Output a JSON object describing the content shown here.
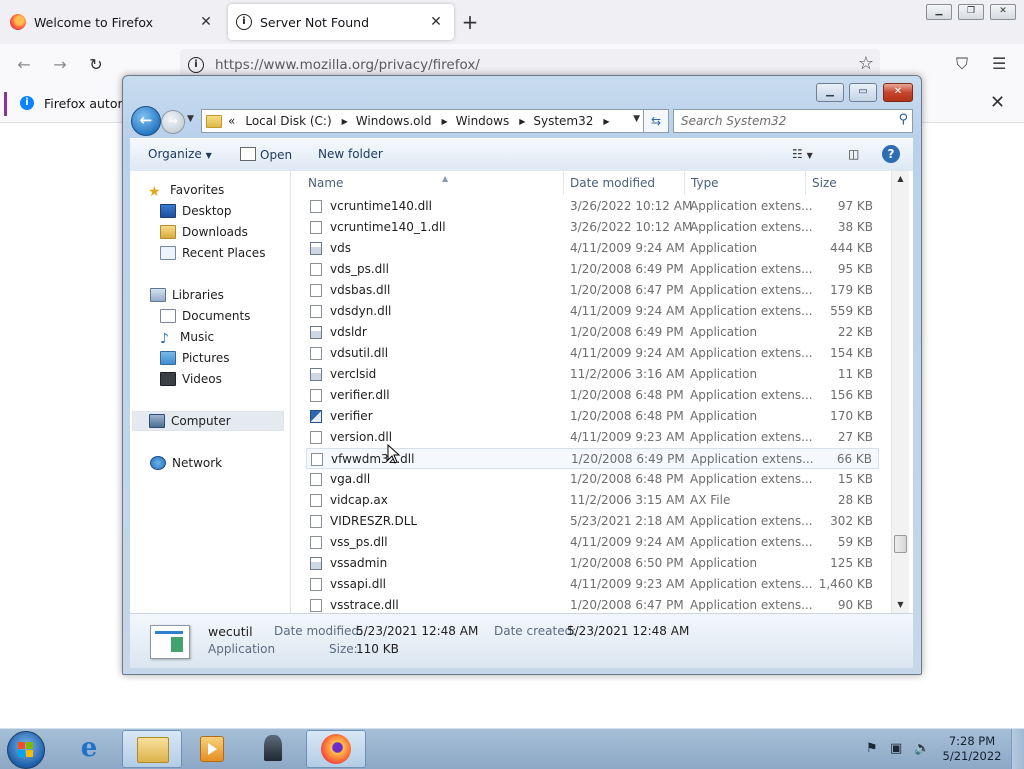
{
  "browser": {
    "tabs": [
      {
        "title": "Welcome to Firefox",
        "active": false
      },
      {
        "title": "Server Not Found",
        "active": true
      }
    ],
    "url": "https://www.mozilla.org/privacy/firefox/",
    "notification": "Firefox automa",
    "icons": {
      "back": "back-arrow-icon",
      "forward": "forward-arrow-icon",
      "reload": "reload-icon",
      "bookmark": "star-icon",
      "pocket": "pocket-icon",
      "menu": "hamburger-menu-icon"
    }
  },
  "explorer": {
    "breadcrumbs": [
      "Local Disk (C:)",
      "Windows.old",
      "Windows",
      "System32"
    ],
    "breadcrumb_prefix": "«",
    "search_placeholder": "Search System32",
    "toolbar": {
      "organize": "Organize",
      "open": "Open",
      "new_folder": "New folder"
    },
    "nav": {
      "favorites": "Favorites",
      "desktop": "Desktop",
      "downloads": "Downloads",
      "recent": "Recent Places",
      "libraries": "Libraries",
      "documents": "Documents",
      "music": "Music",
      "pictures": "Pictures",
      "videos": "Videos",
      "computer": "Computer",
      "network": "Network"
    },
    "columns": {
      "name": "Name",
      "date": "Date modified",
      "type": "Type",
      "size": "Size"
    },
    "files": [
      {
        "name": "vcruntime140.dll",
        "date": "3/26/2022 10:12 AM",
        "type": "Application extens...",
        "size": "97 KB",
        "icon": "dll"
      },
      {
        "name": "vcruntime140_1.dll",
        "date": "3/26/2022 10:12 AM",
        "type": "Application extens...",
        "size": "38 KB",
        "icon": "dll"
      },
      {
        "name": "vds",
        "date": "4/11/2009 9:24 AM",
        "type": "Application",
        "size": "444 KB",
        "icon": "app"
      },
      {
        "name": "vds_ps.dll",
        "date": "1/20/2008 6:49 PM",
        "type": "Application extens...",
        "size": "95 KB",
        "icon": "dll"
      },
      {
        "name": "vdsbas.dll",
        "date": "1/20/2008 6:47 PM",
        "type": "Application extens...",
        "size": "179 KB",
        "icon": "dll"
      },
      {
        "name": "vdsdyn.dll",
        "date": "4/11/2009 9:24 AM",
        "type": "Application extens...",
        "size": "559 KB",
        "icon": "dll"
      },
      {
        "name": "vdsldr",
        "date": "1/20/2008 6:49 PM",
        "type": "Application",
        "size": "22 KB",
        "icon": "app"
      },
      {
        "name": "vdsutil.dll",
        "date": "4/11/2009 9:24 AM",
        "type": "Application extens...",
        "size": "154 KB",
        "icon": "dll"
      },
      {
        "name": "verclsid",
        "date": "11/2/2006 3:16 AM",
        "type": "Application",
        "size": "11 KB",
        "icon": "app"
      },
      {
        "name": "verifier.dll",
        "date": "1/20/2008 6:48 PM",
        "type": "Application extens...",
        "size": "156 KB",
        "icon": "dll"
      },
      {
        "name": "verifier",
        "date": "1/20/2008 6:48 PM",
        "type": "Application",
        "size": "170 KB",
        "icon": "ver"
      },
      {
        "name": "version.dll",
        "date": "4/11/2009 9:23 AM",
        "type": "Application extens...",
        "size": "27 KB",
        "icon": "dll"
      },
      {
        "name": "vfwwdm32.dll",
        "date": "1/20/2008 6:49 PM",
        "type": "Application extens...",
        "size": "66 KB",
        "icon": "dll",
        "hover": true
      },
      {
        "name": "vga.dll",
        "date": "1/20/2008 6:48 PM",
        "type": "Application extens...",
        "size": "15 KB",
        "icon": "dll"
      },
      {
        "name": "vidcap.ax",
        "date": "11/2/2006 3:15 AM",
        "type": "AX File",
        "size": "28 KB",
        "icon": "blank"
      },
      {
        "name": "VIDRESZR.DLL",
        "date": "5/23/2021 2:18 AM",
        "type": "Application extens...",
        "size": "302 KB",
        "icon": "dll"
      },
      {
        "name": "vss_ps.dll",
        "date": "4/11/2009 9:24 AM",
        "type": "Application extens...",
        "size": "59 KB",
        "icon": "dll"
      },
      {
        "name": "vssadmin",
        "date": "1/20/2008 6:50 PM",
        "type": "Application",
        "size": "125 KB",
        "icon": "app"
      },
      {
        "name": "vssapi.dll",
        "date": "4/11/2009 9:23 AM",
        "type": "Application extens...",
        "size": "1,460 KB",
        "icon": "dll"
      },
      {
        "name": "vsstrace.dll",
        "date": "1/20/2008 6:47 PM",
        "type": "Application extens...",
        "size": "90 KB",
        "icon": "dll"
      }
    ],
    "details": {
      "name": "wecutil",
      "type": "Application",
      "date_modified_label": "Date modified:",
      "date_modified": "5/23/2021 12:48 AM",
      "date_created_label": "Date created:",
      "date_created": "5/23/2021 12:48 AM",
      "size_label": "Size:",
      "size": "110 KB"
    }
  },
  "taskbar": {
    "time": "7:28 PM",
    "date": "5/21/2022",
    "apps": [
      "internet-explorer-icon",
      "windows-explorer-icon",
      "media-player-icon",
      "chess-icon",
      "firefox-icon"
    ]
  }
}
